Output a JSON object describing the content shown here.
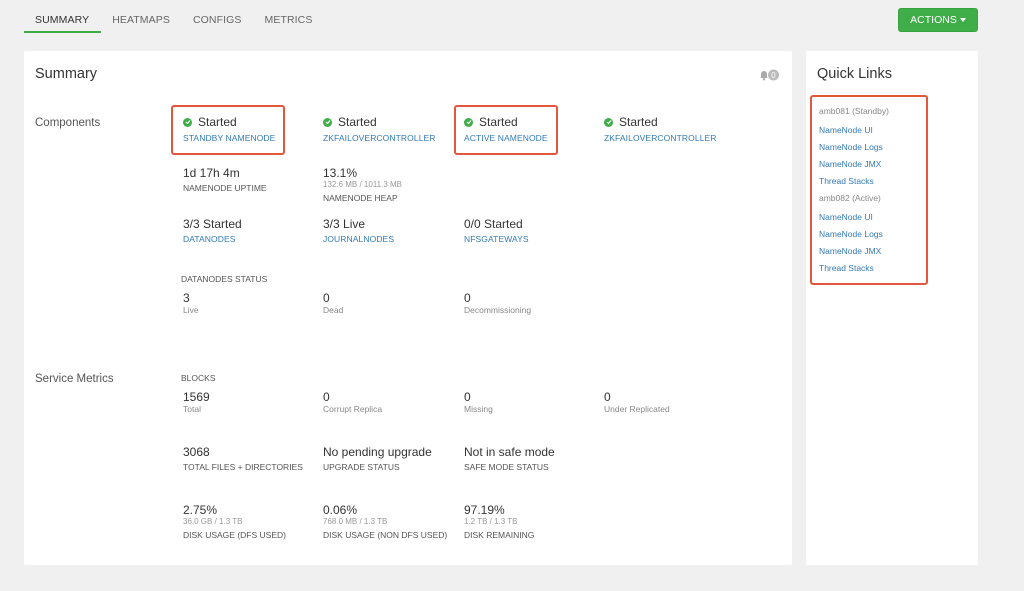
{
  "tabs": [
    "SUMMARY",
    "HEATMAPS",
    "CONFIGS",
    "METRICS"
  ],
  "actions_label": "ACTIONS",
  "summary": {
    "title": "Summary",
    "notification_count": "0",
    "components_label": "Components",
    "components": [
      {
        "status": "Started",
        "name": "STANDBY NAMENODE"
      },
      {
        "status": "Started",
        "name": "ZKFAILOVERCONTROLLER"
      },
      {
        "status": "Started",
        "name": "ACTIVE NAMENODE"
      },
      {
        "status": "Started",
        "name": "ZKFAILOVERCONTROLLER"
      }
    ],
    "uptime": {
      "value": "1d 17h 4m",
      "label": "NAMENODE UPTIME"
    },
    "heap": {
      "value": "13.1%",
      "detail": "132.6 MB / 1011.3 MB",
      "label": "NAMENODE HEAP"
    },
    "datanodes": {
      "value": "3/3 Started",
      "link": "DATANODES"
    },
    "journalnodes": {
      "value": "3/3 Live",
      "link": "JOURNALNODES"
    },
    "nfsgateways": {
      "value": "0/0 Started",
      "link": "NFSGATEWAYS"
    },
    "datanodes_status": {
      "label": "DATANODES STATUS",
      "items": [
        {
          "value": "3",
          "label": "Live"
        },
        {
          "value": "0",
          "label": "Dead"
        },
        {
          "value": "0",
          "label": "Decommissioning"
        }
      ]
    },
    "service_metrics_label": "Service Metrics",
    "blocks": {
      "label": "BLOCKS",
      "items": [
        {
          "value": "1569",
          "label": "Total"
        },
        {
          "value": "0",
          "label": "Corrupt Replica"
        },
        {
          "value": "0",
          "label": "Missing"
        },
        {
          "value": "0",
          "label": "Under Replicated"
        }
      ]
    },
    "files": {
      "value": "3068",
      "label": "TOTAL FILES + DIRECTORIES"
    },
    "upgrade": {
      "value": "No pending upgrade",
      "label": "UPGRADE STATUS"
    },
    "safemode": {
      "value": "Not in safe mode",
      "label": "SAFE MODE STATUS"
    },
    "disk": [
      {
        "value": "2.75%",
        "detail": "36.0 GB / 1.3 TB",
        "label": "DISK USAGE (DFS USED)"
      },
      {
        "value": "0.06%",
        "detail": "768.0 MB / 1.3 TB",
        "label": "DISK USAGE (NON DFS USED)"
      },
      {
        "value": "97.19%",
        "detail": "1.2 TB / 1.3 TB",
        "label": "DISK REMAINING"
      }
    ]
  },
  "quick_links": {
    "title": "Quick Links",
    "groups": [
      {
        "host": "amb081 (Standby)",
        "links": [
          "NameNode UI",
          "NameNode Logs",
          "NameNode JMX",
          "Thread Stacks"
        ]
      },
      {
        "host": "amb082 (Active)",
        "links": [
          "NameNode UI",
          "NameNode Logs",
          "NameNode JMX",
          "Thread Stacks"
        ]
      }
    ]
  },
  "colors": {
    "accent": "#3fae49",
    "link": "#337ab7",
    "highlight": "#e2563b"
  }
}
